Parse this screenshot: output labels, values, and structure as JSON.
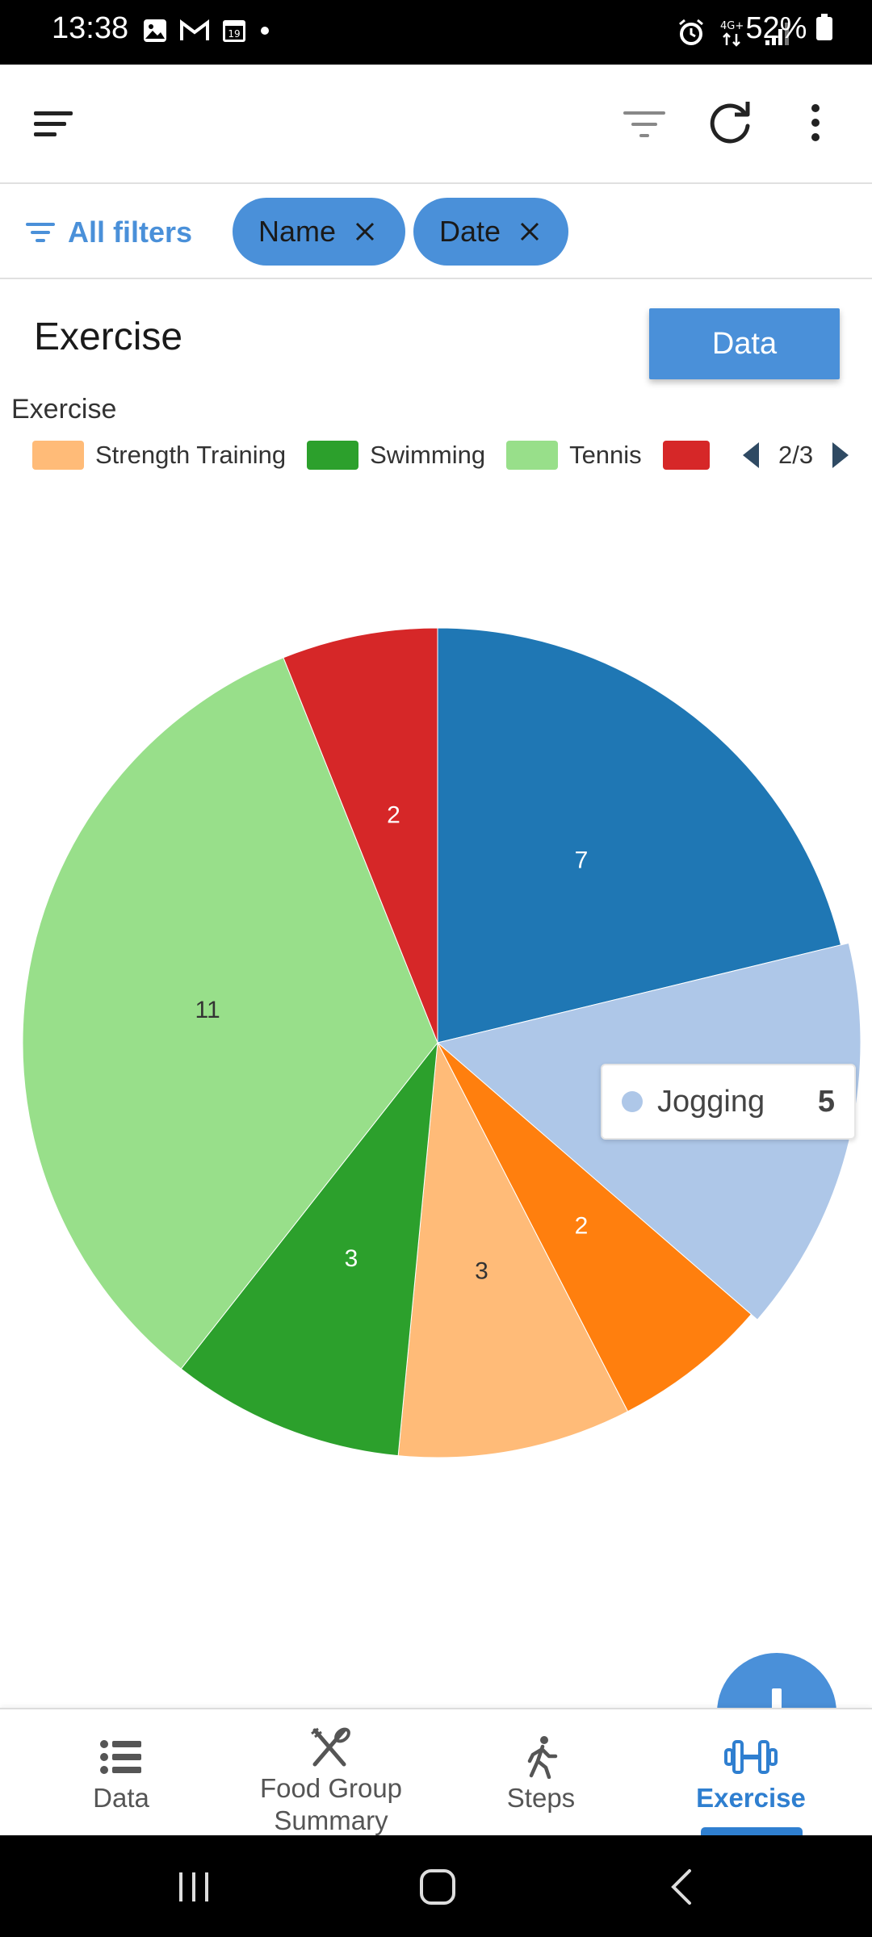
{
  "status_bar": {
    "time": "13:38",
    "battery": "52%",
    "network": "4G+"
  },
  "app_bar": {
    "icons": [
      "menu-icon",
      "filter-icon",
      "refresh-icon",
      "more-vert-icon"
    ]
  },
  "filters": {
    "all_filters_label": "All filters",
    "chips": [
      {
        "label": "Name"
      },
      {
        "label": "Date"
      }
    ]
  },
  "section": {
    "title": "Exercise",
    "data_button_label": "Data"
  },
  "legend": {
    "title": "Exercise",
    "items": [
      {
        "label": "Strength Training",
        "color": "#ffbb78"
      },
      {
        "label": "Swimming",
        "color": "#2ca02c"
      },
      {
        "label": "Tennis",
        "color": "#98df8a"
      },
      {
        "label": "",
        "color": "#d62728"
      }
    ],
    "page_indicator": "2/3"
  },
  "chart_data": {
    "type": "pie",
    "title": "",
    "slices": [
      {
        "value": 7,
        "color": "#1f77b4",
        "label": "7"
      },
      {
        "name": "Jogging",
        "value": 5,
        "color": "#aec7e8",
        "label": "",
        "highlighted": true
      },
      {
        "value": 2,
        "color": "#ff7f0e",
        "label": "2"
      },
      {
        "name": "Strength Training",
        "value": 3,
        "color": "#ffbb78",
        "label": "3"
      },
      {
        "name": "Swimming",
        "value": 3,
        "color": "#2ca02c",
        "label": "3"
      },
      {
        "name": "Tennis",
        "value": 11,
        "color": "#98df8a",
        "label": "11"
      },
      {
        "value": 2,
        "color": "#d62728",
        "label": "2"
      }
    ]
  },
  "tooltip": {
    "name": "Jogging",
    "value": "5"
  },
  "bottom_nav": {
    "items": [
      {
        "label": "Data",
        "icon": "list-icon",
        "active": false
      },
      {
        "label_line1": "Food Group",
        "label_line2": "Summary",
        "icon": "utensils-icon",
        "active": false
      },
      {
        "label": "Steps",
        "icon": "walking-icon",
        "active": false
      },
      {
        "label": "Exercise",
        "icon": "dumbbell-icon",
        "active": true
      }
    ]
  },
  "colors": {
    "accent": "#4a90d9",
    "active_nav": "#2f7fd0"
  }
}
